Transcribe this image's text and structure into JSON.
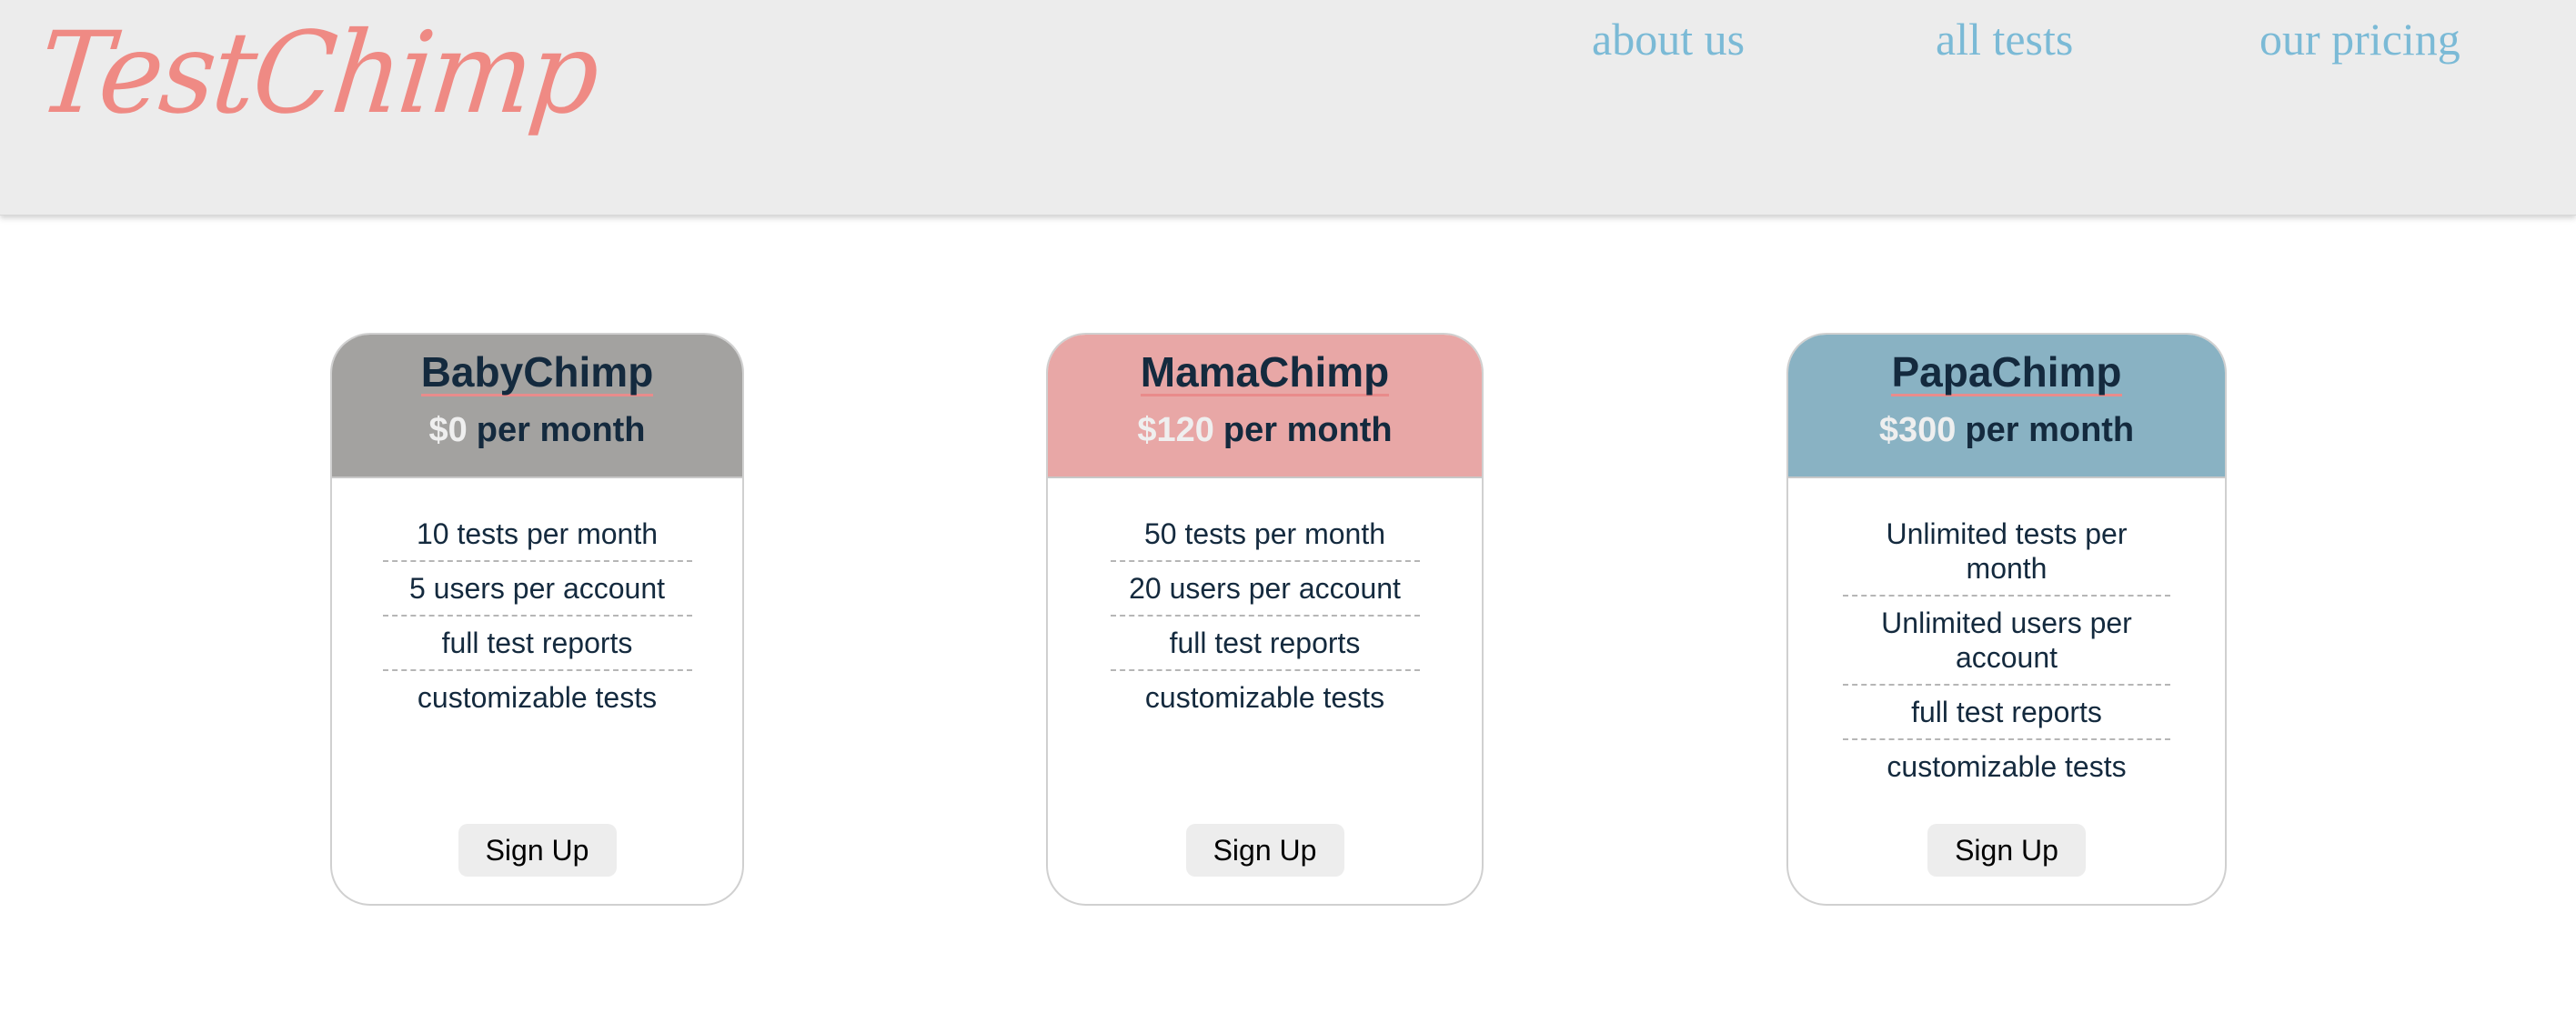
{
  "header": {
    "logo_text": "TestChimp",
    "nav": [
      {
        "label": "about us"
      },
      {
        "label": "all tests"
      },
      {
        "label": "our pricing"
      }
    ]
  },
  "colors": {
    "header_bg": "#ececec",
    "logo": "#ef8a84",
    "nav_link": "#7bbad6",
    "text_dark": "#142a3e",
    "price_amount": "#efefef",
    "name_underline": "#e98b8b",
    "baby_header": "#a3a2a0",
    "mama_header": "#e8a7a6",
    "papa_header": "#89b2c3",
    "button_bg": "#ededed"
  },
  "plans": [
    {
      "name": "BabyChimp",
      "price": "$0",
      "period": "per month",
      "features": [
        "10 tests per month",
        "5 users per account",
        "full test reports",
        "customizable tests"
      ],
      "button": "Sign Up"
    },
    {
      "name": "MamaChimp",
      "price": "$120",
      "period": "per month",
      "features": [
        "50 tests per month",
        "20 users per account",
        "full test reports",
        "customizable tests"
      ],
      "button": "Sign Up"
    },
    {
      "name": "PapaChimp",
      "price": "$300",
      "period": "per month",
      "features": [
        "Unlimited tests per month",
        "Unlimited users per account",
        "full test reports",
        "customizable tests"
      ],
      "button": "Sign Up"
    }
  ]
}
